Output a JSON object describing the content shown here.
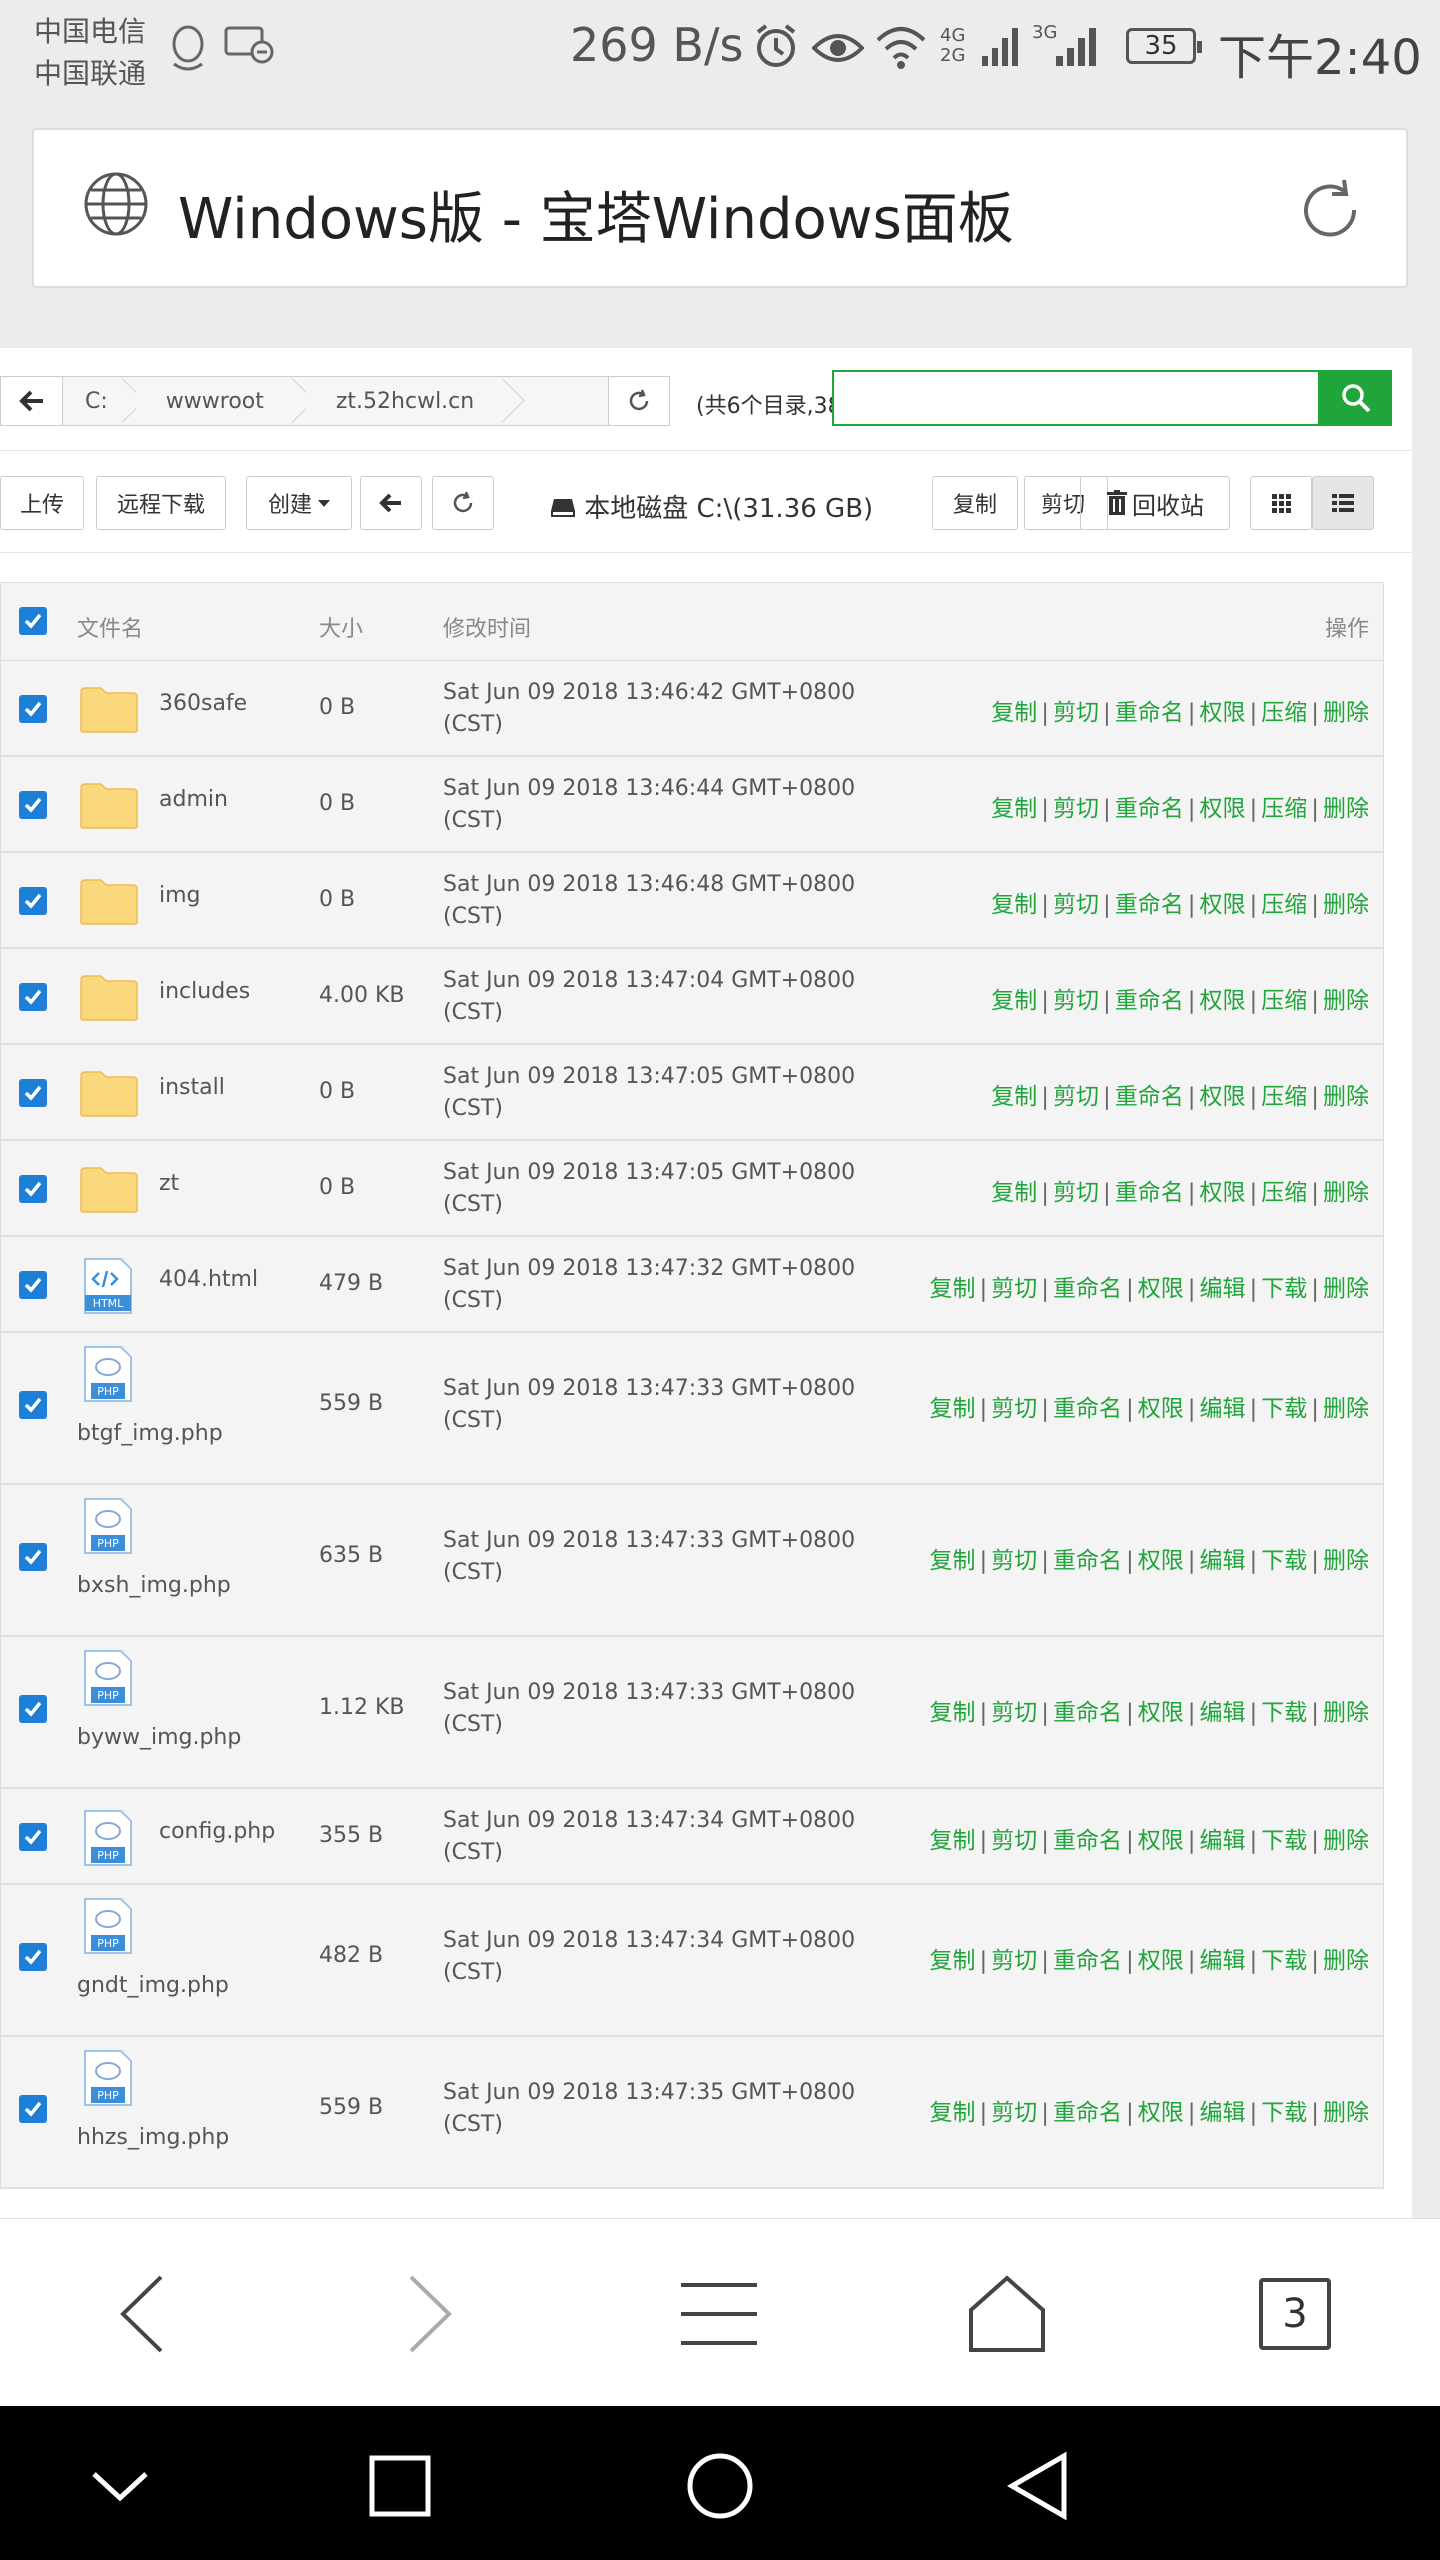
{
  "status_bar": {
    "carrier_1": "中国电信",
    "carrier_2": "中国联通",
    "net_speed": "269 B/s",
    "signal_1": "4G 2G",
    "signal_2": "3G",
    "battery": "35",
    "time": "下午2:40"
  },
  "browser": {
    "page_title": "Windows版 - 宝塔Windows面板",
    "tab_count": "3"
  },
  "path_bar": {
    "segments": [
      "C:",
      "wwwroot",
      "zt.52hcwl.cn"
    ],
    "dir_count": "(共6个目录,38",
    "search_placeholder": ""
  },
  "toolbar": {
    "upload": "上传",
    "remote_download": "远程下载",
    "create": "创建",
    "disk": "本地磁盘 C:\\(31.36 GB)",
    "copy": "复制",
    "cut": "剪切",
    "recycle_bin": "回收站"
  },
  "table": {
    "headers": {
      "name": "文件名",
      "size": "大小",
      "mtime": "修改时间",
      "actions": "操作"
    },
    "folder_ops": [
      "复制",
      "剪切",
      "重命名",
      "权限",
      "压缩",
      "删除"
    ],
    "file_ops": [
      "复制",
      "剪切",
      "重命名",
      "权限",
      "编辑",
      "下载",
      "删除"
    ],
    "rows": [
      {
        "name": "360safe",
        "size": "0 B",
        "time1": "Sat Jun 09 2018 13:46:42 GMT+0800",
        "time2": "(CST)",
        "type": "folder"
      },
      {
        "name": "admin",
        "size": "0 B",
        "time1": "Sat Jun 09 2018 13:46:44 GMT+0800",
        "time2": "(CST)",
        "type": "folder"
      },
      {
        "name": "img",
        "size": "0 B",
        "time1": "Sat Jun 09 2018 13:46:48 GMT+0800",
        "time2": "(CST)",
        "type": "folder"
      },
      {
        "name": "includes",
        "size": "4.00 KB",
        "time1": "Sat Jun 09 2018 13:47:04 GMT+0800",
        "time2": "(CST)",
        "type": "folder"
      },
      {
        "name": "install",
        "size": "0 B",
        "time1": "Sat Jun 09 2018 13:47:05 GMT+0800",
        "time2": "(CST)",
        "type": "folder"
      },
      {
        "name": "zt",
        "size": "0 B",
        "time1": "Sat Jun 09 2018 13:47:05 GMT+0800",
        "time2": "(CST)",
        "type": "folder"
      },
      {
        "name": "404.html",
        "size": "479 B",
        "time1": "Sat Jun 09 2018 13:47:32 GMT+0800",
        "time2": "(CST)",
        "type": "html"
      },
      {
        "name": "btgf_img.php",
        "size": "559 B",
        "time1": "Sat Jun 09 2018 13:47:33 GMT+0800",
        "time2": "(CST)",
        "type": "php"
      },
      {
        "name": "bxsh_img.php",
        "size": "635 B",
        "time1": "Sat Jun 09 2018 13:47:33 GMT+0800",
        "time2": "(CST)",
        "type": "php"
      },
      {
        "name": "byww_img.php",
        "size": "1.12 KB",
        "time1": "Sat Jun 09 2018 13:47:33 GMT+0800",
        "time2": "(CST)",
        "type": "php"
      },
      {
        "name": "config.php",
        "size": "355 B",
        "time1": "Sat Jun 09 2018 13:47:34 GMT+0800",
        "time2": "(CST)",
        "type": "php"
      },
      {
        "name": "gndt_img.php",
        "size": "482 B",
        "time1": "Sat Jun 09 2018 13:47:34 GMT+0800",
        "time2": "(CST)",
        "type": "php"
      },
      {
        "name": "hhzs_img.php",
        "size": "559 B",
        "time1": "Sat Jun 09 2018 13:47:35 GMT+0800",
        "time2": "(CST)",
        "type": "php"
      }
    ]
  },
  "colors": {
    "accent": "#20a53a",
    "checkbox": "#1e7fd6",
    "folder": "#f9d77a"
  },
  "icons": [
    "globe-icon",
    "reload-icon",
    "back-arrow-icon",
    "refresh-icon",
    "search-icon",
    "hdd-icon",
    "trash-icon",
    "grid-view-icon",
    "list-view-icon",
    "folder-icon",
    "html-file-icon",
    "php-file-icon"
  ]
}
